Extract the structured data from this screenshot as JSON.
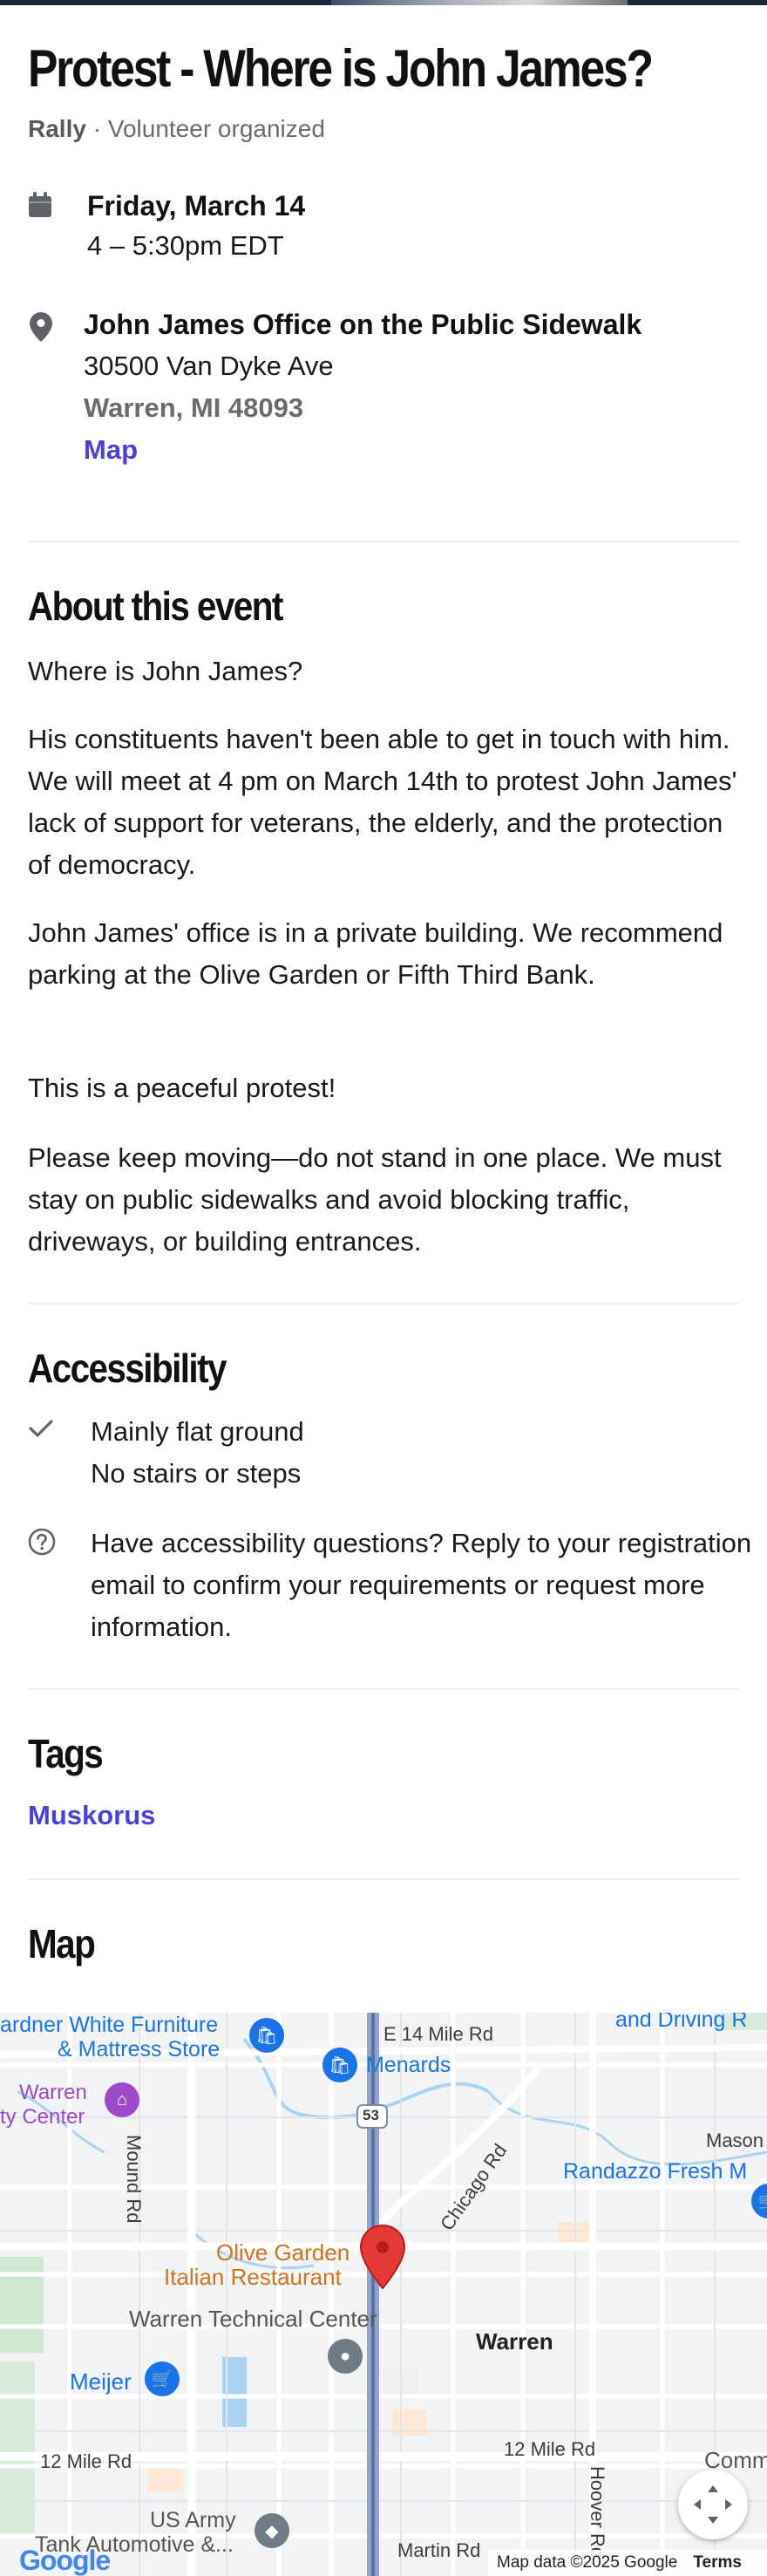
{
  "event": {
    "title": "Protest - Where is John James?",
    "type": "Rally",
    "organizer": "· Volunteer organized"
  },
  "datetime": {
    "date": "Friday, March 14",
    "time": "4 – 5:30pm EDT"
  },
  "location": {
    "name": "John James Office on the Public Sidewalk",
    "address_line1": "30500 Van Dyke Ave",
    "address_line2": "Warren, MI 48093",
    "map_link": "Map"
  },
  "about": {
    "heading": "About this event",
    "paragraphs": [
      "Where is John James?",
      "His constituents haven't been able to get in touch with him. We will meet at 4 pm on March 14th to protest John James' lack of support for veterans, the elderly, and the protection of democracy.",
      "John James' office is in a private building. We recommend parking at the Olive Garden or Fifth Third Bank.",
      "This is a peaceful protest!",
      "Please keep moving—do not stand in one place. We must stay on public sidewalks and avoid blocking traffic, driveways, or building entrances."
    ]
  },
  "accessibility": {
    "heading": "Accessibility",
    "features": [
      "Mainly flat ground",
      "No stairs or steps"
    ],
    "question": "Have accessibility questions? Reply to your registration email to confirm your requirements or request more information."
  },
  "tags": {
    "heading": "Tags",
    "items": [
      "Muskorus"
    ]
  },
  "map": {
    "heading": "Map",
    "labels": {
      "gardner": "ardner White Furniture",
      "mattress": "& Mattress Store",
      "menards": "Menards",
      "e14": "E 14 Mile Rd",
      "driving": "and Driving R",
      "warren_city1": "Warren",
      "warren_city2": "ty Center",
      "mound": "Mound Rd",
      "route53": "53",
      "chicago": "Chicago Rd",
      "mason": "Mason",
      "randazzo": "Randazzo Fresh M",
      "olive1": "Olive Garden",
      "olive2": "Italian Restaurant",
      "warren_tech": "Warren Technical Center",
      "warren": "Warren",
      "meijer": "Meijer",
      "twelve_left": "12 Mile Rd",
      "twelve_right": "12 Mile Rd",
      "hoover": "Hoover Rd",
      "comm": "Comm",
      "usarmy1": "US Army",
      "usarmy2": "Tank Automotive &...",
      "martin": "Martin Rd",
      "google": "Google",
      "attribution": "Map data ©2025 Google",
      "terms": "Terms"
    }
  },
  "colors": {
    "accent_link": "#4b3fe0",
    "map_pin": "#e53935",
    "poi_blue": "#1a73e8",
    "poi_purple": "#9c4ac9",
    "poi_orange": "#d2721e"
  }
}
